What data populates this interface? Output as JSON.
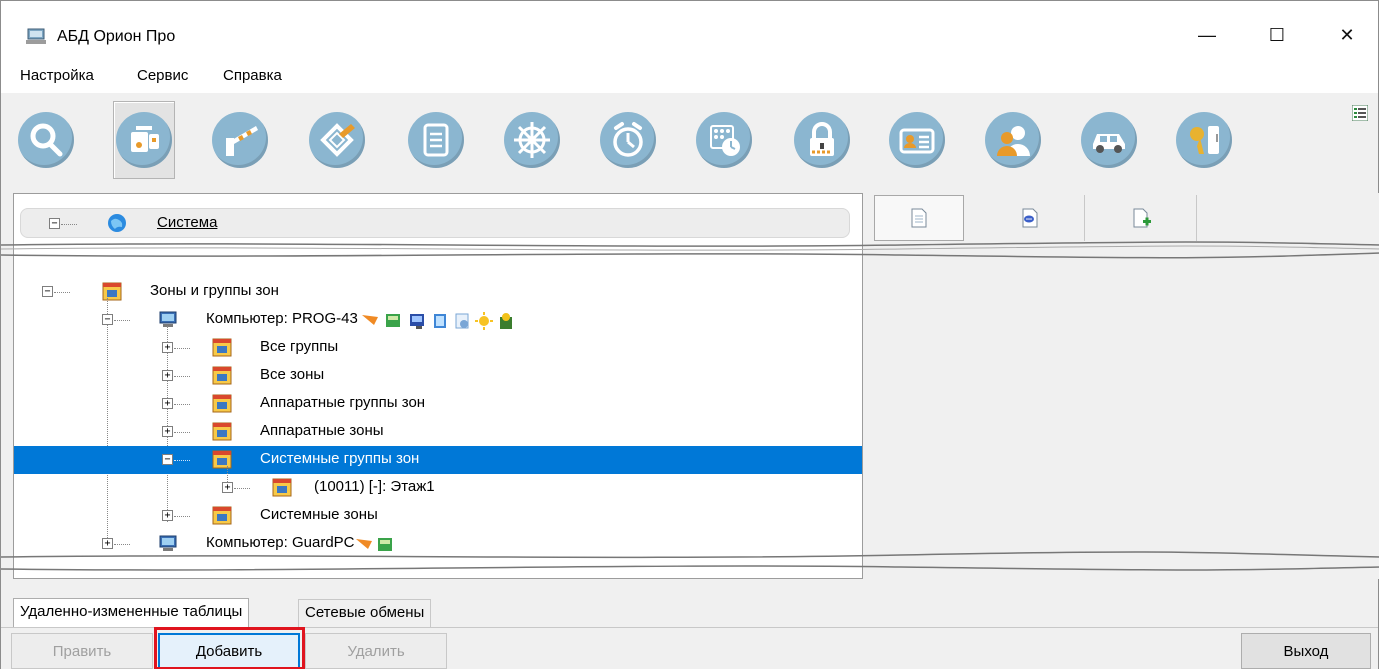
{
  "window": {
    "title": "АБД Орион Про",
    "controls": {
      "minimize": "—",
      "maximize": "☐",
      "close": "✕"
    }
  },
  "menu": [
    "Настройка",
    "Сервис",
    "Справка"
  ],
  "toolbar": {
    "buttons": [
      {
        "icon": "search-icon"
      },
      {
        "icon": "devices-icon",
        "active": true
      },
      {
        "icon": "barrier-icon"
      },
      {
        "icon": "floor-plan-icon"
      },
      {
        "icon": "document-list-icon"
      },
      {
        "icon": "wheel-icon"
      },
      {
        "icon": "alarm-clock-icon"
      },
      {
        "icon": "schedule-icon"
      },
      {
        "icon": "lock-icon"
      },
      {
        "icon": "id-card-icon"
      },
      {
        "icon": "users-icon"
      },
      {
        "icon": "car-icon"
      },
      {
        "icon": "key-icon"
      }
    ]
  },
  "tree": {
    "root": "Система",
    "nodes": [
      {
        "label": "Зоны и группы зон",
        "level": 0,
        "expander": "−"
      },
      {
        "label": "Компьютер: PROG-43",
        "level": 1,
        "expander": "−"
      },
      {
        "label": "Все группы",
        "level": 2,
        "expander": "+"
      },
      {
        "label": "Все зоны",
        "level": 2,
        "expander": "+"
      },
      {
        "label": "Аппаратные группы зон",
        "level": 2,
        "expander": "+"
      },
      {
        "label": "Аппаратные зоны",
        "level": 2,
        "expander": "+"
      },
      {
        "label": "Системные группы зон",
        "level": 2,
        "expander": "−",
        "selected": true
      },
      {
        "label": "(10011) [-]: Этаж1",
        "level": 3,
        "expander": "+"
      },
      {
        "label": "Системные зоны",
        "level": 2,
        "expander": "+"
      },
      {
        "label": "Компьютер: GuardPC",
        "level": 1,
        "expander": "+"
      }
    ]
  },
  "tabs": [
    "Удаленно-измененные таблицы",
    "Сетевые обмены"
  ],
  "buttons": {
    "edit": "Править",
    "add": "Добавить",
    "delete": "Удалить",
    "exit": "Выход"
  },
  "colors": {
    "selection": "#0078d7",
    "icon_circle": "#8bb6d0",
    "highlight": "#e0141e"
  }
}
